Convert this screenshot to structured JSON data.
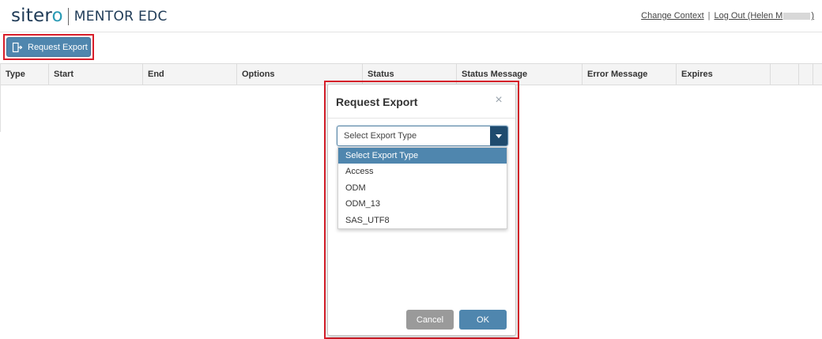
{
  "brand": {
    "logo_word_prefix": "siter",
    "logo_word_accent": "o",
    "product_name": "MENTOR",
    "product_suffix": "EDC"
  },
  "header_links": {
    "change_context": "Change Context",
    "separator": "|",
    "logout_prefix": "Log Out (Helen M",
    "logout_suffix": ")"
  },
  "toolbar": {
    "request_export_label": "Request Export",
    "request_export_icon": "export-icon"
  },
  "table": {
    "columns": [
      "Type",
      "Start",
      "End",
      "Options",
      "Status",
      "Status Message",
      "Error Message",
      "Expires"
    ]
  },
  "dialog": {
    "title": "Request Export",
    "close_glyph": "×",
    "select": {
      "value": "Select Export Type",
      "options": [
        "Select Export Type",
        "Access",
        "ODM",
        "ODM_13",
        "SAS_UTF8"
      ],
      "selected_index": 0
    },
    "cancel_label": "Cancel",
    "ok_label": "OK"
  },
  "colors": {
    "primary_button": "#4f86ae",
    "cancel_button": "#9a9a9a",
    "highlight_border": "#d81e2a",
    "select_arrow_bg": "#1f4b6e",
    "brand_navy": "#1f3b57",
    "brand_teal": "#2a9bb5"
  }
}
